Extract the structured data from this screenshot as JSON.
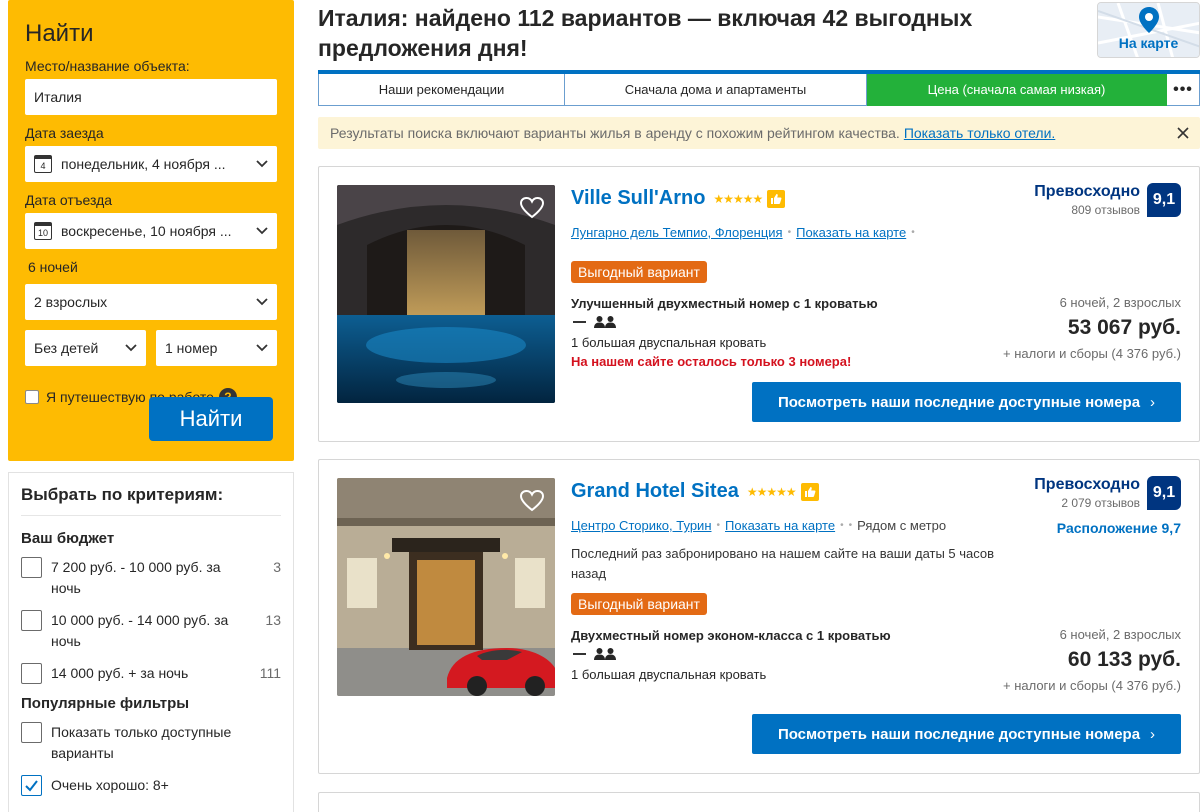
{
  "search": {
    "title": "Найти",
    "destination_label": "Место/название объекта:",
    "destination_value": "Италия",
    "checkin_label": "Дата заезда",
    "checkin_day": "4",
    "checkin_value": "понедельник, 4 ноября ...",
    "checkout_label": "Дата отъезда",
    "checkout_day": "10",
    "checkout_value": "воскресенье, 10 ноября ...",
    "nights": "6 ночей",
    "adults": "2 взрослых",
    "children": "Без детей",
    "rooms": "1 номер",
    "business_label": "Я путешествую по работе",
    "help_glyph": "?",
    "button": "Найти"
  },
  "filters": {
    "title": "Выбрать по критериям:",
    "budget_title": "Ваш бюджет",
    "budget": [
      {
        "label": "7 200 руб. - 10 000 руб. за ночь",
        "count": "3"
      },
      {
        "label": "10 000 руб. - 14 000 руб. за ночь",
        "count": "13"
      },
      {
        "label": "14 000 руб. + за ночь",
        "count": "111"
      }
    ],
    "popular_title": "Популярные фильтры",
    "popular": [
      {
        "label": "Показать только доступные варианты",
        "checked": false
      },
      {
        "label": "Очень хорошо: 8+",
        "checked": true
      }
    ]
  },
  "header": {
    "title": "Италия: найдено 112 вариантов — включая 42 выгодных предложения дня!",
    "map_button": "На карте"
  },
  "sort": {
    "tabs": [
      "Наши рекомендации",
      "Сначала дома и апартаменты",
      "Цена (сначала самая низкая)",
      "•••"
    ],
    "active": 2
  },
  "notice": {
    "text": "Результаты поиска включают варианты жилья в аренду с похожим рейтингом качества.",
    "link": "Показать только отели."
  },
  "hotels": [
    {
      "name": "Ville Sull'Arno",
      "stars": "★★★★★",
      "location": "Лунгарно дель Темпио, Флоренция",
      "map_link": "Показать на карте",
      "deal": "Выгодный вариант",
      "room": "Улучшенный двухместный номер с 1 кроватью",
      "bed": "1 большая двуспальная кровать",
      "urgent": "На нашем сайте осталось только 3 номера!",
      "review_word": "Превосходно",
      "review_count": "809 отзывов",
      "score": "9,1",
      "stay": "6 ночей, 2 взрослых",
      "price": "53 067 руб.",
      "taxes": "+ налоги и сборы (4 376 руб.)",
      "cta": "Посмотреть наши последние доступные номера"
    },
    {
      "name": "Grand Hotel Sitea",
      "stars": "★★★★★",
      "location": "Центро Сторико, Турин",
      "map_link": "Показать на карте",
      "metro": "Рядом с метро",
      "last_booked": "Последний раз забронировано на нашем сайте на ваши даты 5 часов назад",
      "deal": "Выгодный вариант",
      "room": "Двухместный номер эконом-класса с 1 кроватью",
      "bed": "1 большая двуспальная кровать",
      "review_word": "Превосходно",
      "review_count": "2 079 отзывов",
      "score": "9,1",
      "location_score": "Расположение 9,7",
      "stay": "6 ночей, 2 взрослых",
      "price": "60 133 руб.",
      "taxes": "+ налоги и сборы (4 376 руб.)",
      "cta": "Посмотреть наши последние доступные номера"
    }
  ],
  "colors": {
    "brand_blue": "#0071c2",
    "search_yellow": "#febb02",
    "score_navy": "#003580",
    "deal_orange": "#e36a14",
    "active_tab_green": "#23b13a",
    "urgent_red": "#d4111e"
  }
}
